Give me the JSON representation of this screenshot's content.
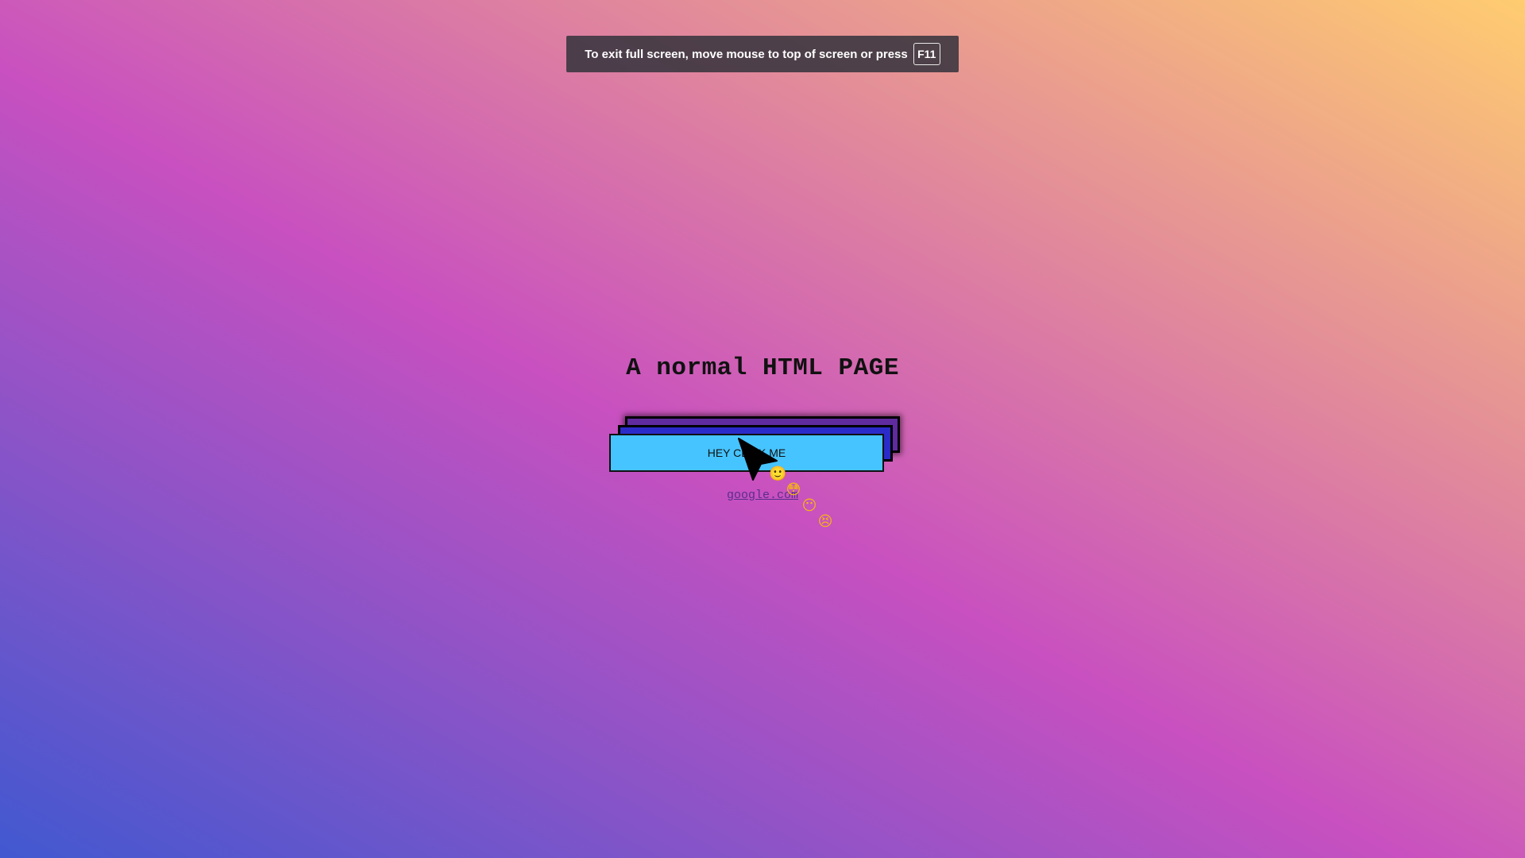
{
  "fullscreen_notice": {
    "message": "To exit full screen, move mouse to top of screen or press",
    "key": "F11"
  },
  "page": {
    "title": "A normal HTML PAGE",
    "button_label": "HEY CLICK ME",
    "link_text": "google.com"
  },
  "cursor_trail": {
    "emojis": [
      "🙂",
      "😳",
      "😶",
      "😣"
    ]
  },
  "colors": {
    "button_fill": "#46c4ff",
    "gradient": [
      "#4158d0",
      "#c850c0",
      "#ffcc70"
    ]
  }
}
